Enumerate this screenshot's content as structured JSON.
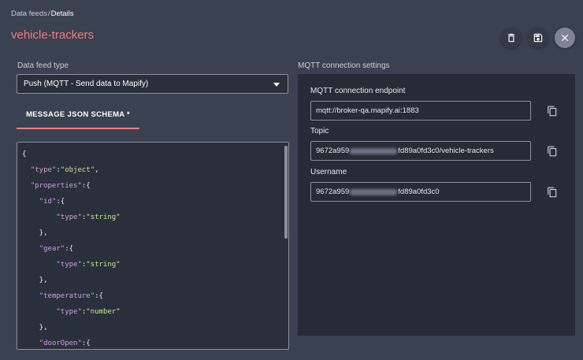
{
  "breadcrumb": {
    "parent": "Data feeds",
    "separator": "/",
    "current": "Details"
  },
  "page_title": "vehicle-trackers",
  "actions": [
    "trash-icon",
    "save-icon",
    "close-icon"
  ],
  "feed_type": {
    "label": "Data feed type",
    "value": "Push (MQTT - Send data to Mapify)"
  },
  "tab": {
    "label": "MESSAGE JSON SCHEMA *"
  },
  "json_schema": [
    "{",
    "  \"type\":\"object\",",
    "  \"properties\":{",
    "    \"id\":{",
    "        \"type\":\"string\"",
    "    },",
    "    \"gear\":{",
    "        \"type\":\"string\"",
    "    },",
    "    \"temperature\":{",
    "        \"type\":\"number\"",
    "    },",
    "    \"doorOpen\":{"
  ],
  "mqtt": {
    "section_label": "MQTT connection settings",
    "endpoint": {
      "label": "MQTT connection endpoint",
      "value": "mqtt://broker-qa.mapify.ai:1883"
    },
    "topic": {
      "label": "Topic",
      "prefix": "9672a959",
      "suffix": "fd89a0fd3c0/vehicle-trackers"
    },
    "username": {
      "label": "Username",
      "prefix": "9672a959",
      "suffix": "fd89a0fd3c0"
    }
  },
  "colors": {
    "accent": "#ef7d7d",
    "background": "#3a4150",
    "panel": "#262c36",
    "json_key": "#d59ae6",
    "json_string": "#c3e88d"
  }
}
